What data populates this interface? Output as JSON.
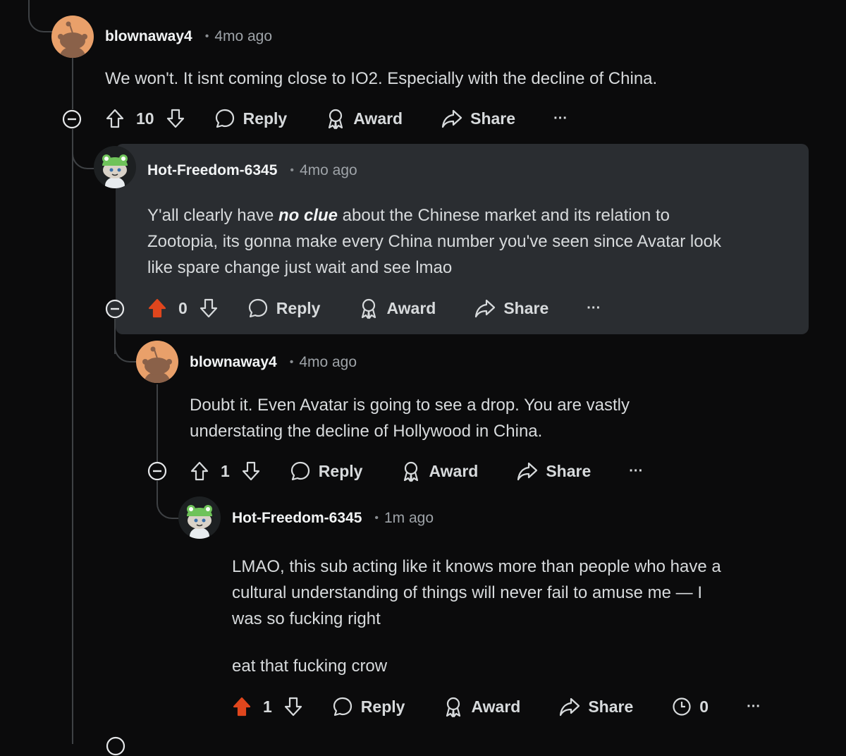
{
  "comments": [
    {
      "username": "blownaway4",
      "time": "4mo ago",
      "body": [
        "We won't. It isnt coming close to IO2. Especially with the decline of China."
      ],
      "score": "10",
      "upvoted": false
    },
    {
      "username": "Hot-Freedom-6345",
      "time": "4mo ago",
      "body_pre": "Y'all clearly have ",
      "body_em": "no clue",
      "body_post": " about the Chinese market and its relation to",
      "body_line2": "Zootopia, its gonna make every China number you've seen since Avatar look",
      "body_line3": "like spare change just wait and see lmao",
      "score": "0",
      "upvoted": true,
      "highlighted": true
    },
    {
      "username": "blownaway4",
      "time": "4mo ago",
      "body": [
        "Doubt it. Even Avatar is going to see a drop. You are vastly",
        "understating the decline of Hollywood in China."
      ],
      "score": "1",
      "upvoted": false
    },
    {
      "username": "Hot-Freedom-6345",
      "time": "1m ago",
      "body": [
        "LMAO, this sub acting like it knows more than people who have a",
        "cultural understanding of things will never fail to amuse me — I",
        "was so fucking right"
      ],
      "body_para2": "eat that fucking crow",
      "score": "1",
      "upvoted": true,
      "insight_count": "0"
    }
  ],
  "actions": {
    "reply": "Reply",
    "award": "Award",
    "share": "Share",
    "more": "···"
  },
  "colors": {
    "background": "#0b0b0c",
    "highlight": "#2a2d31",
    "upvote_active": "#e0461d",
    "thread_line": "#3e4144",
    "snoo_orange": "#e9a06a"
  },
  "icons": [
    "collapse-icon",
    "upvote-icon",
    "downvote-icon",
    "reply-icon",
    "award-icon",
    "share-icon",
    "more-icon",
    "insights-icon"
  ]
}
